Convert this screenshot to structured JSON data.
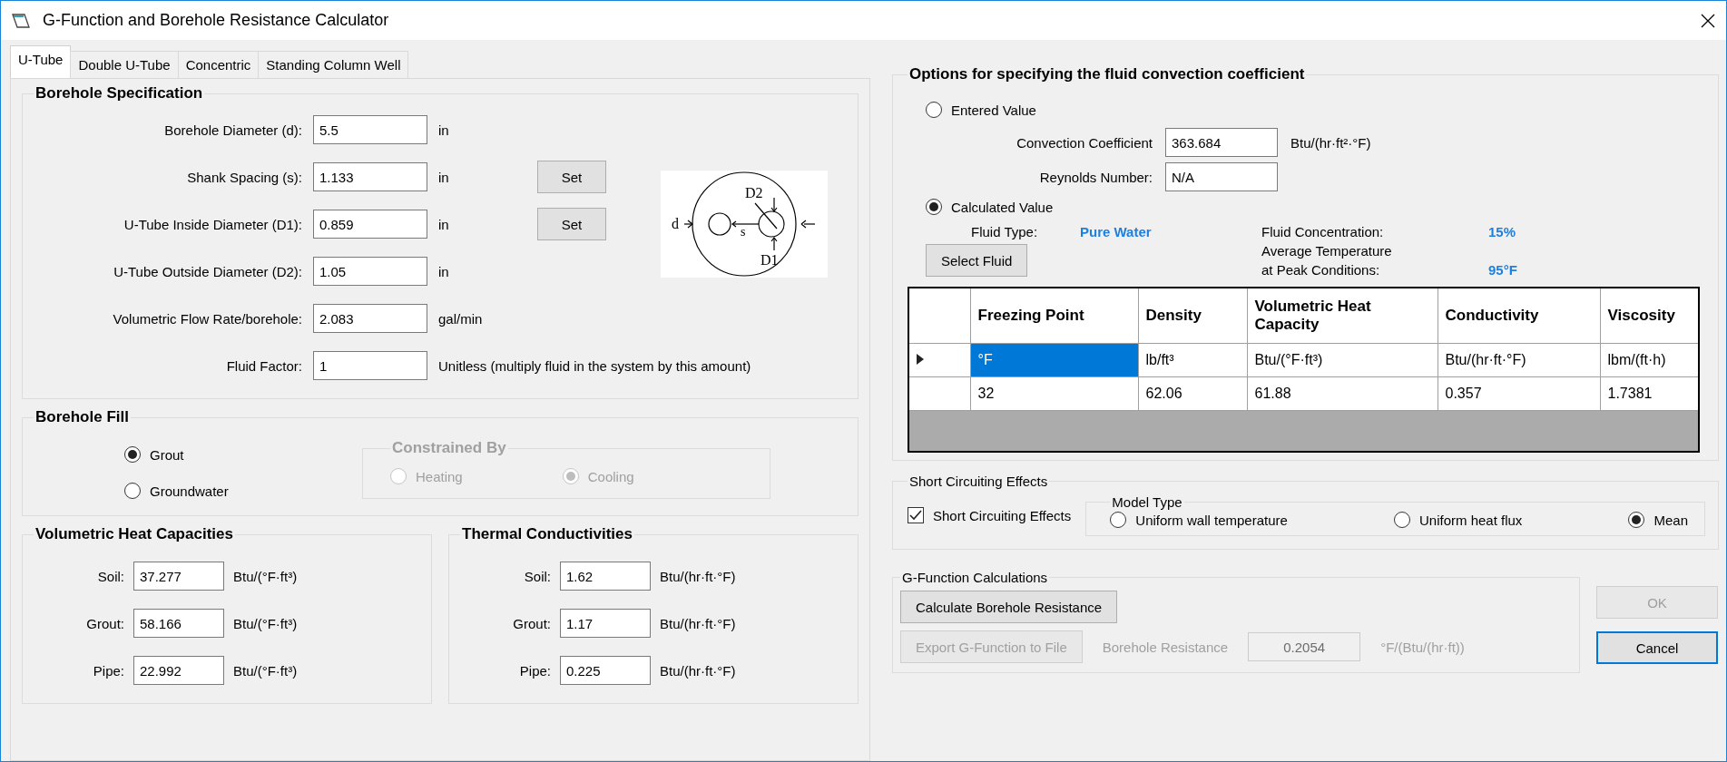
{
  "window": {
    "title": "G-Function and Borehole Resistance Calculator"
  },
  "tabs": [
    {
      "label": "U-Tube",
      "selected": true
    },
    {
      "label": "Double U-Tube",
      "selected": false
    },
    {
      "label": "Concentric",
      "selected": false
    },
    {
      "label": "Standing Column Well",
      "selected": false
    }
  ],
  "borehole_specification": {
    "title": "Borehole Specification",
    "fields": [
      {
        "label": "Borehole Diameter (d):",
        "value": "5.5",
        "unit": "in"
      },
      {
        "label": "Shank Spacing (s):",
        "value": "1.133",
        "unit": "in",
        "button": "Set"
      },
      {
        "label": "U-Tube Inside Diameter (D1):",
        "value": "0.859",
        "unit": "in",
        "button": "Set"
      },
      {
        "label": "U-Tube Outside Diameter (D2):",
        "value": "1.05",
        "unit": "in"
      },
      {
        "label": "Volumetric Flow Rate/borehole:",
        "value": "2.083",
        "unit": "gal/min"
      },
      {
        "label": "Fluid Factor:",
        "value": "1",
        "unit": "Unitless (multiply fluid in the system by this amount)"
      }
    ],
    "diagram_labels": {
      "d2": "D2",
      "d": "d",
      "s": "s",
      "d1": "D1"
    }
  },
  "borehole_fill": {
    "title": "Borehole Fill",
    "options": [
      {
        "label": "Grout",
        "selected": true
      },
      {
        "label": "Groundwater",
        "selected": false
      }
    ],
    "constrained_by": {
      "title": "Constrained By",
      "disabled": true,
      "options": [
        {
          "label": "Heating",
          "selected": false
        },
        {
          "label": "Cooling",
          "selected": true
        }
      ]
    }
  },
  "volumetric_heat_capacities": {
    "title": "Volumetric Heat Capacities",
    "fields": [
      {
        "label": "Soil:",
        "value": "37.277",
        "unit": "Btu/(°F·ft³)"
      },
      {
        "label": "Grout:",
        "value": "58.166",
        "unit": "Btu/(°F·ft³)"
      },
      {
        "label": "Pipe:",
        "value": "22.992",
        "unit": "Btu/(°F·ft³)"
      }
    ]
  },
  "thermal_conductivities": {
    "title": "Thermal Conductivities",
    "fields": [
      {
        "label": "Soil:",
        "value": "1.62",
        "unit": "Btu/(hr·ft·°F)"
      },
      {
        "label": "Grout:",
        "value": "1.17",
        "unit": "Btu/(hr·ft·°F)"
      },
      {
        "label": "Pipe:",
        "value": "0.225",
        "unit": "Btu/(hr·ft·°F)"
      }
    ]
  },
  "convection": {
    "title": "Options for specifying the fluid convection coefficient",
    "entered_value": {
      "label": "Entered Value",
      "selected": false
    },
    "convection_coefficient": {
      "label": "Convection Coefficient",
      "value": "363.684",
      "unit": "Btu/(hr·ft²·°F)"
    },
    "reynolds_number": {
      "label": "Reynolds Number:",
      "value": "N/A"
    },
    "calculated_value": {
      "label": "Calculated Value",
      "selected": true
    },
    "fluid_type": {
      "label": "Fluid Type:",
      "value": "Pure Water"
    },
    "fluid_concentration": {
      "label": "Fluid Concentration:",
      "value": "15%"
    },
    "average_temperature": {
      "label_lines": [
        "Average Temperature",
        "at Peak Conditions:"
      ],
      "value": "95°F"
    },
    "select_fluid_button": "Select Fluid",
    "table": {
      "columns": [
        "Freezing Point",
        "Density",
        "Volumetric Heat Capacity",
        "Conductivity",
        "Viscosity"
      ],
      "rows": [
        {
          "current": true,
          "cells": [
            {
              "text": "°F",
              "selected": true
            },
            {
              "text": "lb/ft³",
              "selected": false
            },
            {
              "text": "Btu/(°F·ft³)",
              "selected": false
            },
            {
              "text": "Btu/(hr·ft·°F)",
              "selected": false
            },
            {
              "text": "lbm/(ft·h)",
              "selected": false
            }
          ]
        },
        {
          "current": false,
          "cells": [
            {
              "text": "32",
              "selected": false
            },
            {
              "text": "62.06",
              "selected": false
            },
            {
              "text": "61.88",
              "selected": false
            },
            {
              "text": "0.357",
              "selected": false
            },
            {
              "text": "1.7381",
              "selected": false
            }
          ]
        }
      ]
    }
  },
  "short_circuiting": {
    "title": "Short Circuiting Effects",
    "checkbox": {
      "label": "Short Circuiting Effects",
      "checked": true
    },
    "model_type": {
      "title": "Model Type",
      "options": [
        {
          "label": "Uniform wall temperature",
          "selected": false
        },
        {
          "label": "Uniform heat flux",
          "selected": false
        },
        {
          "label": "Mean",
          "selected": true
        }
      ]
    }
  },
  "g_function": {
    "title": "G-Function Calculations",
    "calculate_button": {
      "label": "Calculate Borehole Resistance",
      "disabled": false
    },
    "export_button": {
      "label": "Export G-Function to File",
      "disabled": true
    },
    "resistance": {
      "label": "Borehole Resistance",
      "value": "0.2054",
      "unit": "°F/(Btu/(hr·ft))",
      "disabled": true
    }
  },
  "buttons": [
    {
      "label": "OK",
      "disabled": true,
      "default": false
    },
    {
      "label": "Cancel",
      "disabled": false,
      "default": true
    }
  ]
}
